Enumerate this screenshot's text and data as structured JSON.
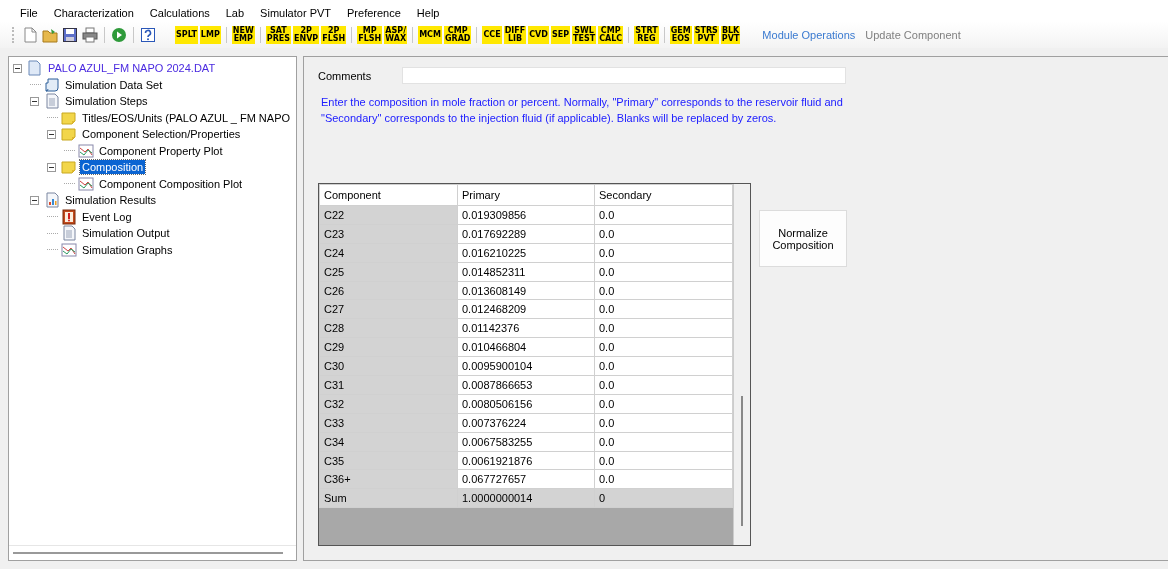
{
  "menu": [
    "File",
    "Characterization",
    "Calculations",
    "Lab",
    "Simulator PVT",
    "Preference",
    "Help"
  ],
  "toolbar": {
    "badge_groups": [
      [
        [
          "SPLT"
        ],
        [
          "LMP"
        ]
      ],
      [
        [
          "NEW",
          "EMP"
        ]
      ],
      [
        [
          "SAT",
          "PRES"
        ],
        [
          "2P",
          "ENVP"
        ],
        [
          "2P",
          "FLSH"
        ]
      ],
      [
        [
          "MP",
          "FLSH"
        ],
        [
          "ASP/",
          "WAX"
        ]
      ],
      [
        [
          "MCM"
        ],
        [
          "CMP",
          "GRAD"
        ]
      ],
      [
        [
          "CCE"
        ],
        [
          "DIFF",
          "LIB"
        ],
        [
          "CVD"
        ],
        [
          "SEP"
        ],
        [
          "SWL",
          "TEST"
        ],
        [
          "CMP",
          "CALC"
        ]
      ],
      [
        [
          "STRT",
          "REG"
        ]
      ],
      [
        [
          "GEM",
          "EOS"
        ],
        [
          "STRS",
          "PVT"
        ],
        [
          "BLK",
          "PVT"
        ]
      ]
    ],
    "links": [
      {
        "label": "Module Operations",
        "disabled": false
      },
      {
        "label": "Update Component",
        "disabled": true
      }
    ]
  },
  "tree": [
    {
      "label": "PALO AZUL_FM NAPO 2024.DAT",
      "kind": "file",
      "expanded": true,
      "selected": false,
      "children": [
        {
          "label": "Simulation Data Set",
          "kind": "scroll",
          "selected": false
        },
        {
          "label": "Simulation Steps",
          "kind": "doc",
          "expanded": true,
          "selected": false,
          "children": [
            {
              "label": "Titles/EOS/Units (PALO AZUL _ FM NAPO",
              "kind": "note",
              "selected": false
            },
            {
              "label": "Component Selection/Properties",
              "kind": "note",
              "expanded": true,
              "selected": false,
              "children": [
                {
                  "label": "Component Property Plot",
                  "kind": "plot",
                  "selected": false
                }
              ]
            },
            {
              "label": "Composition",
              "kind": "note",
              "expanded": true,
              "selected": true,
              "children": [
                {
                  "label": "Component Composition Plot",
                  "kind": "plot",
                  "selected": false
                }
              ]
            }
          ]
        },
        {
          "label": "Simulation Results",
          "kind": "chartdoc",
          "expanded": true,
          "selected": false,
          "children": [
            {
              "label": "Event Log",
              "kind": "log",
              "selected": false
            },
            {
              "label": "Simulation Output",
              "kind": "doc",
              "selected": false
            },
            {
              "label": "Simulation Graphs",
              "kind": "plot",
              "selected": false
            }
          ]
        }
      ]
    }
  ],
  "comments": {
    "label": "Comments"
  },
  "instructions": "Enter the composition in mole fraction or percent.  Normally, \"Primary\" corresponds to the reservoir fluid and \"Secondary\" corresponds to the injection fluid (if applicable). Blanks will be replaced by zeros.",
  "table": {
    "columns": [
      "Component",
      "Primary",
      "Secondary"
    ],
    "rows": [
      {
        "kind": "data",
        "cells": [
          "C22",
          "0.019309856",
          "0.0"
        ]
      },
      {
        "kind": "data",
        "cells": [
          "C23",
          "0.017692289",
          "0.0"
        ]
      },
      {
        "kind": "data",
        "cells": [
          "C24",
          "0.016210225",
          "0.0"
        ]
      },
      {
        "kind": "data",
        "cells": [
          "C25",
          "0.014852311",
          "0.0"
        ]
      },
      {
        "kind": "data",
        "cells": [
          "C26",
          "0.013608149",
          "0.0"
        ]
      },
      {
        "kind": "data",
        "cells": [
          "C27",
          "0.012468209",
          "0.0"
        ]
      },
      {
        "kind": "data",
        "cells": [
          "C28",
          "0.01142376",
          "0.0"
        ]
      },
      {
        "kind": "data",
        "cells": [
          "C29",
          "0.010466804",
          "0.0"
        ]
      },
      {
        "kind": "data",
        "cells": [
          "C30",
          "0.0095900104",
          "0.0"
        ]
      },
      {
        "kind": "data",
        "cells": [
          "C31",
          "0.0087866653",
          "0.0"
        ]
      },
      {
        "kind": "data",
        "cells": [
          "C32",
          "0.0080506156",
          "0.0"
        ]
      },
      {
        "kind": "data",
        "cells": [
          "C33",
          "0.007376224",
          "0.0"
        ]
      },
      {
        "kind": "data",
        "cells": [
          "C34",
          "0.0067583255",
          "0.0"
        ]
      },
      {
        "kind": "data",
        "cells": [
          "C35",
          "0.0061921876",
          "0.0"
        ]
      },
      {
        "kind": "data",
        "cells": [
          "C36+",
          "0.067727657",
          "0.0"
        ]
      },
      {
        "kind": "total",
        "cells": [
          "Sum",
          "1.0000000014",
          "0"
        ]
      }
    ]
  },
  "normalize_button": "Normalize Composition"
}
